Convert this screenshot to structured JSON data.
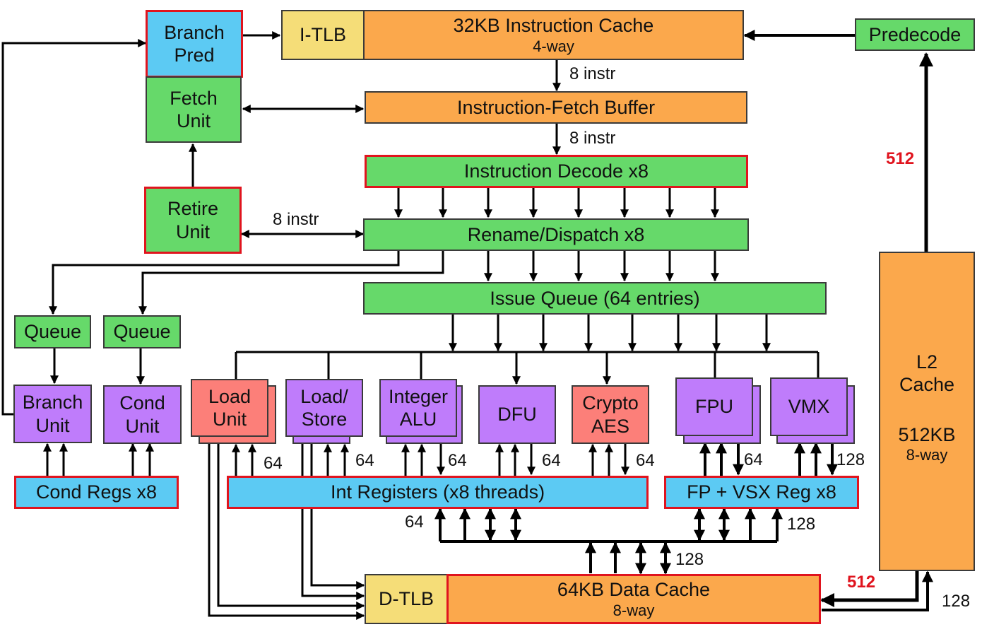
{
  "diagram": {
    "blocks": {
      "branch_pred": "Branch\nPred",
      "fetch_unit": "Fetch\nUnit",
      "retire_unit": "Retire\nUnit",
      "itlb": "I-TLB",
      "icache_title": "32KB Instruction Cache",
      "icache_sub": "4-way",
      "predecode": "Predecode",
      "fetch_buffer": "Instruction-Fetch Buffer",
      "decode": "Instruction Decode x8",
      "rename": "Rename/Dispatch x8",
      "issue_queue": "Issue Queue (64 entries)",
      "queue_branch": "Queue",
      "queue_cond": "Queue",
      "branch_unit": "Branch\nUnit",
      "cond_unit": "Cond\nUnit",
      "cond_regs": "Cond Regs x8",
      "load_unit": "Load\nUnit",
      "load_store": "Load/\nStore",
      "integer_alu": "Integer\nALU",
      "dfu": "DFU",
      "crypto": "Crypto\nAES",
      "fpu": "FPU",
      "vmx": "VMX",
      "int_regs": "Int Registers (x8 threads)",
      "fp_regs": "FP + VSX Reg x8",
      "dtlb": "D-TLB",
      "dcache_title": "64KB Data Cache",
      "dcache_sub": "8-way",
      "l2_title": "L2\nCache",
      "l2_size": "512KB",
      "l2_sub": "8-way"
    },
    "labels": {
      "icache_to_buffer": "8 instr",
      "buffer_to_decode": "8 instr",
      "retire_to_rename": "8 instr",
      "l2_to_predecode": "512",
      "load_unit_width": "64",
      "load_store_width": "64",
      "int_alu_width": "64",
      "dfu_width": "64",
      "crypto_width": "64",
      "fpu_width": "64",
      "vmx_width": "128",
      "int_regs_bus": "64",
      "fp_regs_bus": "128",
      "dcache_bus": "128",
      "l2_to_dcache": "512",
      "dcache_to_l2": "128"
    },
    "colors": {
      "green": "#66d96a",
      "orange": "#fba84c",
      "yellow": "#f5dd78",
      "blue": "#5ccaf3",
      "purple": "#bf7cfb",
      "salmon": "#fc7f79",
      "highlight_border": "#e0141e"
    }
  }
}
